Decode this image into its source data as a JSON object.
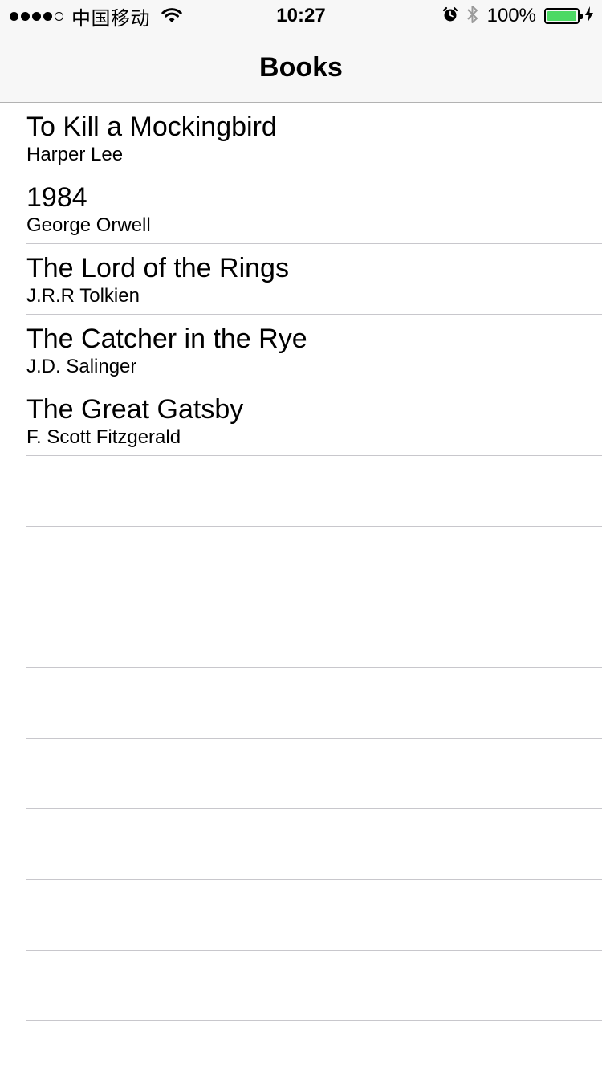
{
  "status_bar": {
    "carrier": "中国移动",
    "time": "10:27",
    "battery_percent": "100%",
    "signal_bars_filled": 4,
    "signal_bars_total": 5,
    "battery_level": 1.0,
    "battery_color": "#4cd964"
  },
  "nav": {
    "title": "Books"
  },
  "books": [
    {
      "title": "To Kill a Mockingbird",
      "author": "Harper Lee"
    },
    {
      "title": "1984",
      "author": "George Orwell"
    },
    {
      "title": "The Lord of the Rings",
      "author": "J.R.R Tolkien"
    },
    {
      "title": "The Catcher in the Rye",
      "author": "J.D. Salinger"
    },
    {
      "title": "The Great Gatsby",
      "author": "F. Scott Fitzgerald"
    }
  ],
  "icons": {
    "wifi": "wifi-icon",
    "alarm": "alarm-icon",
    "bluetooth": "bluetooth-icon",
    "battery": "battery-icon",
    "charging": "charging-bolt-icon"
  }
}
